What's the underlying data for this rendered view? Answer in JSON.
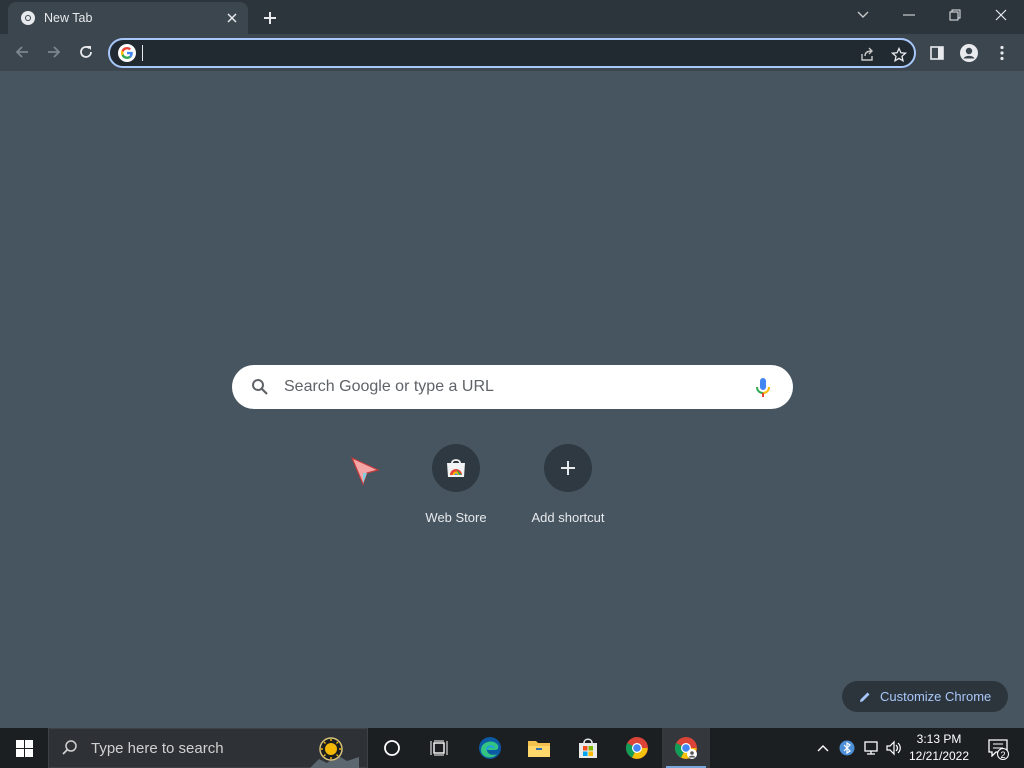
{
  "browser": {
    "tab": {
      "title": "New Tab"
    },
    "omnibox": {
      "value": ""
    }
  },
  "ntp": {
    "search_placeholder": "Search Google or type a URL",
    "shortcuts": [
      {
        "label": "Web Store",
        "icon": "web-store-icon"
      },
      {
        "label": "Add shortcut",
        "icon": "plus-icon"
      }
    ],
    "customize_label": "Customize Chrome"
  },
  "taskbar": {
    "search_placeholder": "Type here to search",
    "time": "3:13 PM",
    "date": "12/21/2022",
    "notification_count": "2"
  },
  "colors": {
    "page_bg": "#465560",
    "toolbar_bg": "#3b464e",
    "accent": "#a8c7fa"
  }
}
